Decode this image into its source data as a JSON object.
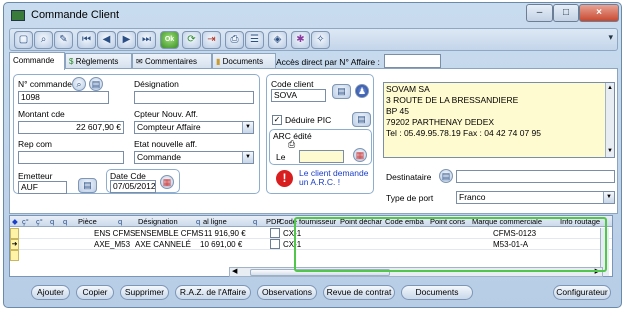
{
  "window": {
    "title": "Commande Client",
    "minimize": "–",
    "maximize": "□",
    "close": "×"
  },
  "toolbar": {
    "icons": [
      "new-doc-icon",
      "search-icon",
      "edit-icon",
      "first-icon",
      "prev-icon",
      "next-icon",
      "last-icon",
      "ok-icon",
      "refresh-icon",
      "exit-icon",
      "print-icon",
      "edit-list-icon",
      "bucket-icon",
      "settings-icon",
      "tools-icon"
    ],
    "ok_label": "Ok",
    "dropdown": "▾"
  },
  "tabs": [
    "Commande",
    "Règlements",
    "Commentaires",
    "Documents"
  ],
  "access": {
    "label": "Accès direct par N° Affaire :",
    "value": ""
  },
  "form": {
    "num_label": "N° commande",
    "num_value": "1098",
    "designation_label": "Désignation",
    "designation_value": "",
    "montant_label": "Montant cde",
    "montant_value": "22 607,90 €",
    "cpteur_label": "Cpteur Nouv. Aff.",
    "cpteur_value": "Compteur Affaire",
    "repcom_label": "Rep com",
    "repcom_value": "",
    "etat_label": "Etat nouvelle aff.",
    "etat_value": "Commande",
    "emetteur_label": "Emetteur",
    "emetteur_value": "AUF",
    "datecde_label": "Date Cde",
    "datecde_value": "07/05/2012"
  },
  "client": {
    "code_label": "Code client",
    "code_value": "SOVA",
    "deduire_label": "Déduire PIC",
    "arc_label": "ARC édité",
    "le_label": "Le",
    "alert_text": "Le client demande un A.R.C. !",
    "address": [
      "SOVAM SA",
      "3 ROUTE DE LA BRESSANDIERE",
      "BP 45",
      "79202 PARTHENAY DEDEX",
      "Tel : 05.49.95.78.19 Fax : 04 42 74 07 95"
    ],
    "destinataire_label": "Destinataire",
    "destinataire_value": "",
    "typeport_label": "Type de port",
    "typeport_value": "Franco"
  },
  "grid": {
    "headers": [
      "Pièce",
      "Désignation",
      "al ligne",
      "PDP",
      "Code fournisseur",
      "Point déchar",
      "Code emba",
      "Point cons",
      "Marque commerciale",
      "Info routage"
    ],
    "rows": [
      [
        "ENS CFMS",
        "ENSEMBLE CFMS",
        "11 916,90 €",
        "",
        "CX-1",
        "",
        "",
        "",
        "CFMS-0123",
        ""
      ],
      [
        "AXE_M53",
        "AXE CANNELÉ",
        "10 691,00 €",
        "",
        "CX-1",
        "",
        "",
        "",
        "M53-01-A",
        ""
      ]
    ]
  },
  "buttons": {
    "ajouter": "Ajouter",
    "copier": "Copier",
    "supprimer": "Supprimer",
    "raz": "R.A.Z. de l'Affaire",
    "observations": "Observations",
    "revue": "Revue de contrat",
    "documents": "Documents",
    "configurateur": "Configurateur"
  },
  "colors": {
    "highlight": "#52c64b",
    "address_bg": "#fffbd1",
    "alert": "#d81e1e",
    "alert_text": "#1a3ec8"
  }
}
